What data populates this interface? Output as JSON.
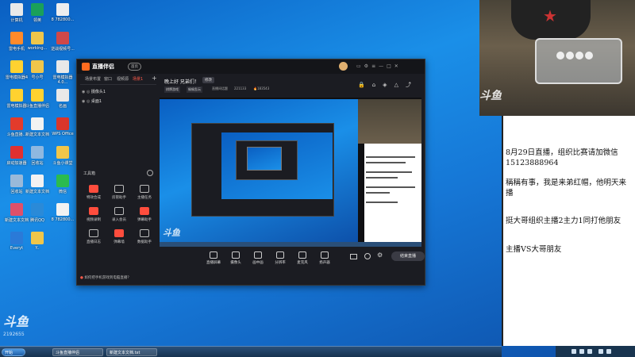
{
  "desktop": {
    "icons": [
      {
        "label": "计算机",
        "color": "#e9e9e9"
      },
      {
        "label": "领英",
        "color": "#1aa05a"
      },
      {
        "label": "8 782800...",
        "color": "#eeeeee"
      },
      {
        "label": "雷电手机",
        "color": "#ff8a2a"
      },
      {
        "label": "working...",
        "color": "#f0c64a"
      },
      {
        "label": "逆战视频号...",
        "color": "#d04848"
      },
      {
        "label": "雷电模拟器4",
        "color": "#ffd230"
      },
      {
        "label": "号小号",
        "color": "#f0c64a"
      },
      {
        "label": "雷电模拟器4.0...",
        "color": "#e8e8e8"
      },
      {
        "label": "雷电模拟器",
        "color": "#ffd230"
      },
      {
        "label": "斗鱼直播伴侣",
        "color": "#ffd230"
      },
      {
        "label": "名画",
        "color": "#e8e8e8"
      },
      {
        "label": "斗鱼直播...",
        "color": "#e23b2b"
      },
      {
        "label": "新建文本文档",
        "color": "#f2f2f2"
      },
      {
        "label": "WPS Office",
        "color": "#d9362b"
      },
      {
        "label": "启动加速器",
        "color": "#e03030"
      },
      {
        "label": "回收站",
        "color": "#8fb8e0"
      },
      {
        "label": "斗鱼小课堂",
        "color": "#f0c64a"
      },
      {
        "label": "回收站",
        "color": "#9ab9d9"
      },
      {
        "label": "新建文本文档",
        "color": "#f2f2f2"
      },
      {
        "label": "微信",
        "color": "#2bbb4f"
      },
      {
        "label": "新建文本文档",
        "color": "#e0506a"
      },
      {
        "label": "腾讯QQ",
        "color": "#2a8ad8"
      },
      {
        "label": "8 782800...",
        "color": "#f2f2f2"
      },
      {
        "label": "Everyt",
        "color": "#2a7ad8"
      },
      {
        "label": "Y..",
        "color": "#f0c64a"
      }
    ],
    "watermark": "斗鱼",
    "room": "2192655"
  },
  "app": {
    "title": "直播伴侣",
    "badge": "首页",
    "nav_tabs": [
      "场景布置",
      "窗口",
      "视频源",
      "场景1"
    ],
    "sources": [
      "摄像头1",
      "桌面1"
    ],
    "tools_header": "工具箱",
    "tools": [
      {
        "label": "特效合成",
        "red": true
      },
      {
        "label": "房管助手",
        "red": false
      },
      {
        "label": "主播任务",
        "red": false
      },
      {
        "label": "视频录制",
        "red": true
      },
      {
        "label": "录入会员",
        "red": false
      },
      {
        "label": "弹幕助手",
        "red": true
      },
      {
        "label": "直播日志",
        "red": false
      },
      {
        "label": "弹幕墙",
        "red": true
      },
      {
        "label": "数据助手",
        "red": false
      }
    ],
    "hint": "如何把手机游戏到电脑直播？",
    "stream_title": "晚上好 兄弟们！",
    "edit_label": "修改",
    "category_tags": [
      "棋牌游戏",
      "偷偷乱玩"
    ],
    "cate_link": "直播间话题",
    "viewers": "221133",
    "heat": "183543",
    "bottom_tools": [
      "直播屏幕",
      "摄像头",
      "画中画",
      "分辨率",
      "麦克风",
      "扬声器"
    ],
    "start_btn": "结束直播"
  },
  "notes": {
    "lines": [
      "8月29日直播，组织比赛请加微信15123888964",
      "稱稱有事，我是来弟红帽，他明天来播",
      "挺大哥组织主播2主力1同打他朋友",
      "主播VS大哥朋友"
    ]
  },
  "taskbar": {
    "start": "开始",
    "apps": [
      "斗鱼直播伴侣",
      "新建文本文档.txt"
    ]
  }
}
